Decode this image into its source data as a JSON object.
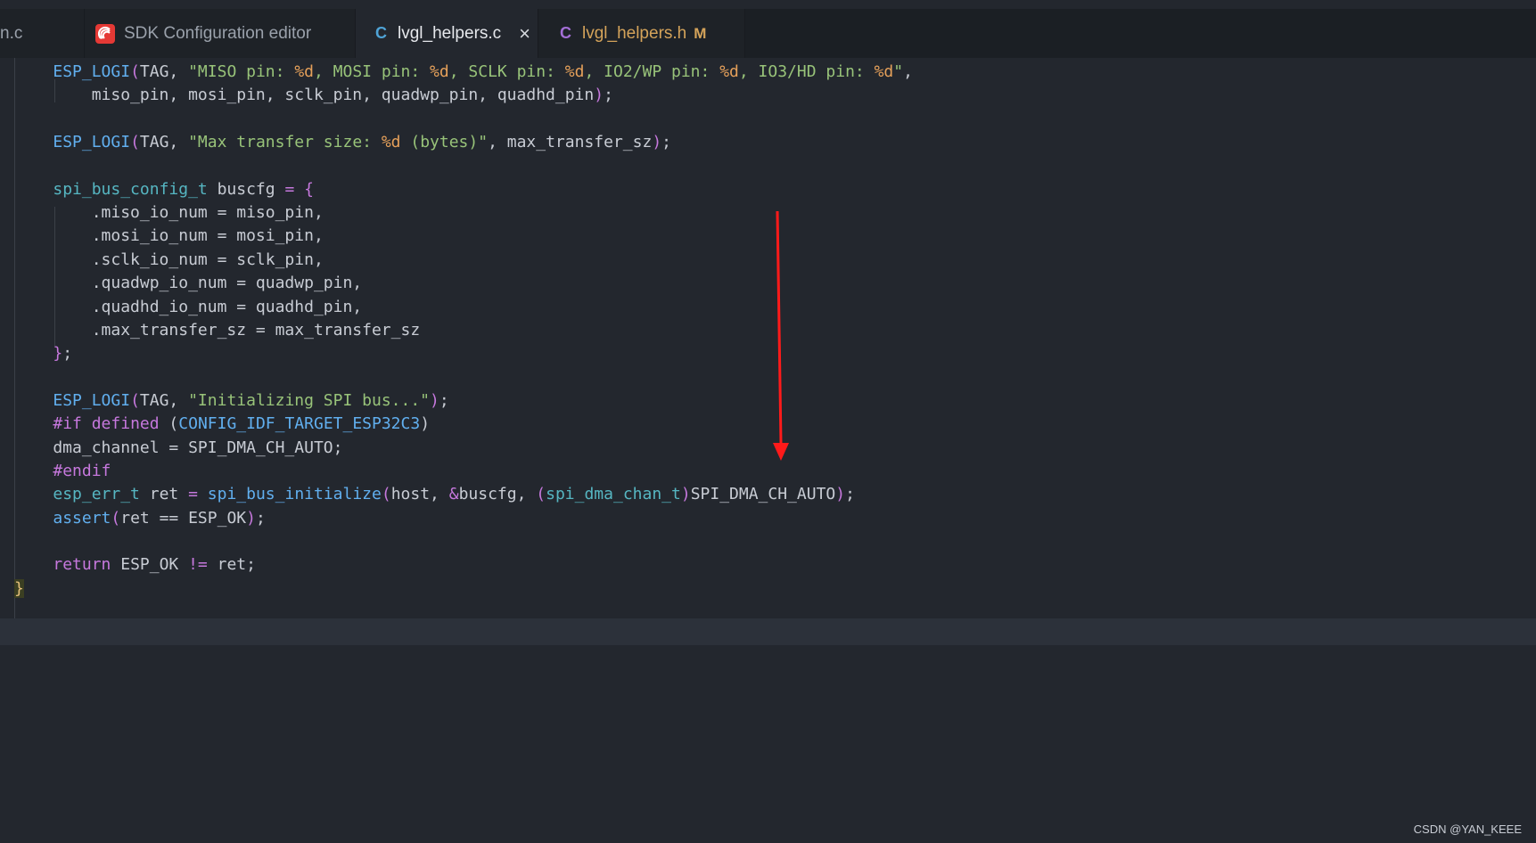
{
  "tabs": [
    {
      "label": "n.c",
      "active": false
    },
    {
      "label": "SDK Configuration editor",
      "icon": "espressif-icon",
      "active": false
    },
    {
      "label": "lvgl_helpers.c",
      "lang": "C",
      "active": true,
      "close": "×"
    },
    {
      "label": "lvgl_helpers.h",
      "lang": "C",
      "active": false,
      "badge": "M"
    }
  ],
  "code_lines": [
    [
      [
        "    ",
        ""
      ],
      [
        "ESP_LOGI",
        "fn"
      ],
      [
        "(",
        "pu"
      ],
      [
        "TAG, ",
        ""
      ],
      [
        "\"MISO pin: ",
        "str"
      ],
      [
        "%d",
        "fmt"
      ],
      [
        ", MOSI pin: ",
        "str"
      ],
      [
        "%d",
        "fmt"
      ],
      [
        ", SCLK pin: ",
        "str"
      ],
      [
        "%d",
        "fmt"
      ],
      [
        ", IO2/WP pin: ",
        "str"
      ],
      [
        "%d",
        "fmt"
      ],
      [
        ", IO3/HD pin: ",
        "str"
      ],
      [
        "%d",
        "fmt"
      ],
      [
        "\"",
        "str"
      ],
      [
        ",",
        ""
      ]
    ],
    [
      [
        "        miso_pin, mosi_pin, sclk_pin, quadwp_pin, quadhd_pin",
        ""
      ],
      [
        ")",
        "pu"
      ],
      [
        ";",
        ""
      ]
    ],
    [
      [
        "",
        ""
      ]
    ],
    [
      [
        "    ",
        ""
      ],
      [
        "ESP_LOGI",
        "fn"
      ],
      [
        "(",
        "pu"
      ],
      [
        "TAG, ",
        ""
      ],
      [
        "\"Max transfer size: ",
        "str"
      ],
      [
        "%d",
        "fmt"
      ],
      [
        " (bytes)\"",
        "str"
      ],
      [
        ", max_transfer_sz",
        ""
      ],
      [
        ")",
        "pu"
      ],
      [
        ";",
        ""
      ]
    ],
    [
      [
        "",
        ""
      ]
    ],
    [
      [
        "    ",
        ""
      ],
      [
        "spi_bus_config_t",
        "ty"
      ],
      [
        " buscfg ",
        ""
      ],
      [
        "=",
        "pu"
      ],
      [
        " ",
        ""
      ],
      [
        "{",
        "pu"
      ]
    ],
    [
      [
        "        .miso_io_num = miso_pin,",
        ""
      ]
    ],
    [
      [
        "        .mosi_io_num = mosi_pin,",
        ""
      ]
    ],
    [
      [
        "        .sclk_io_num = sclk_pin,",
        ""
      ]
    ],
    [
      [
        "        .quadwp_io_num = quadwp_pin,",
        ""
      ]
    ],
    [
      [
        "        .quadhd_io_num = quadhd_pin,",
        ""
      ]
    ],
    [
      [
        "        .max_transfer_sz = max_transfer_sz",
        ""
      ]
    ],
    [
      [
        "    ",
        ""
      ],
      [
        "}",
        "pu"
      ],
      [
        ";",
        ""
      ]
    ],
    [
      [
        "",
        ""
      ]
    ],
    [
      [
        "    ",
        ""
      ],
      [
        "ESP_LOGI",
        "fn"
      ],
      [
        "(",
        "pu"
      ],
      [
        "TAG, ",
        ""
      ],
      [
        "\"Initializing SPI bus...\"",
        "str"
      ],
      [
        ")",
        "pu"
      ],
      [
        ";",
        ""
      ]
    ],
    [
      [
        "    ",
        ""
      ],
      [
        "#if",
        "kw"
      ],
      [
        " ",
        ""
      ],
      [
        "defined",
        "kw"
      ],
      [
        " (",
        ""
      ],
      [
        "CONFIG_IDF_TARGET_ESP32C3",
        "fn"
      ],
      [
        ")",
        ""
      ]
    ],
    [
      [
        "    dma_channel = SPI_DMA_CH_AUTO;",
        ""
      ]
    ],
    [
      [
        "    ",
        ""
      ],
      [
        "#endif",
        "kw"
      ]
    ],
    [
      [
        "    ",
        ""
      ],
      [
        "esp_err_t",
        "ty"
      ],
      [
        " ret ",
        ""
      ],
      [
        "=",
        "pu"
      ],
      [
        " ",
        ""
      ],
      [
        "spi_bus_initialize",
        "fn"
      ],
      [
        "(",
        "pu"
      ],
      [
        "host, ",
        ""
      ],
      [
        "&",
        "pu"
      ],
      [
        "buscfg, ",
        ""
      ],
      [
        "(",
        "pu"
      ],
      [
        "spi_dma_chan_t",
        "ty"
      ],
      [
        ")",
        "pu"
      ],
      [
        "SPI_DMA_CH_AUTO",
        ""
      ],
      [
        ")",
        "pu"
      ],
      [
        ";",
        ""
      ]
    ],
    [
      [
        "    ",
        ""
      ],
      [
        "assert",
        "fn"
      ],
      [
        "(",
        "pu"
      ],
      [
        "ret == ESP_OK",
        ""
      ],
      [
        ")",
        "pu"
      ],
      [
        ";",
        ""
      ]
    ],
    [
      [
        "",
        ""
      ]
    ],
    [
      [
        "    ",
        ""
      ],
      [
        "return",
        "kw"
      ],
      [
        " ESP_OK ",
        ""
      ],
      [
        "!=",
        "pu"
      ],
      [
        " ret;",
        ""
      ]
    ],
    [
      [
        "}",
        "cursor"
      ]
    ]
  ],
  "watermark": "CSDN @YAN_KEEE",
  "colors": {
    "background": "#23272e",
    "function": "#61afef",
    "string": "#98c379",
    "format": "#e5a05a",
    "keyword": "#c678dd",
    "type": "#56b6c2",
    "annotation_arrow": "#ff1a1a"
  }
}
